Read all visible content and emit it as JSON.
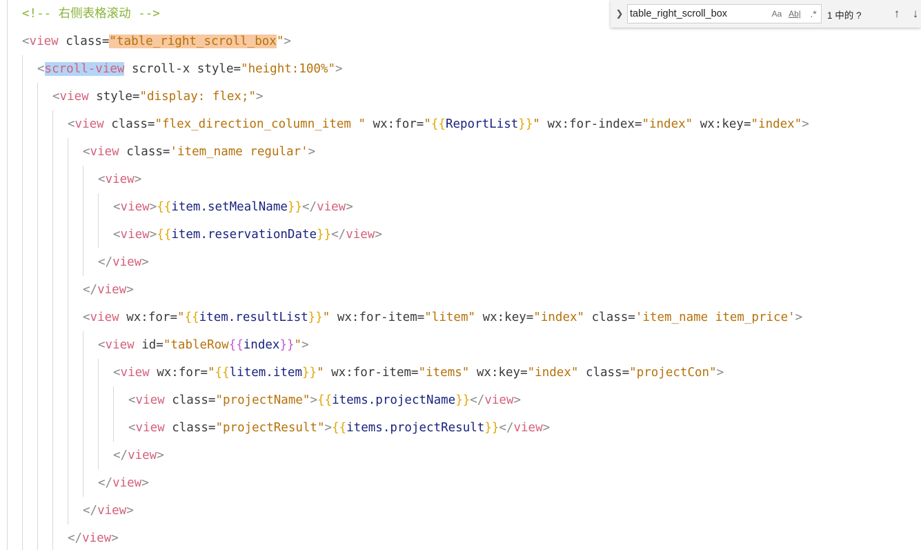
{
  "find_widget": {
    "toggle_icon": "chevron-right-icon",
    "query": "table_right_scroll_box",
    "match_case_label": "Aa",
    "whole_word_label": "Ab|",
    "regex_label": ".*",
    "match_count": "1 中的 ?",
    "prev_icon": "arrow-up-icon",
    "next_icon": "arrow-down-icon"
  },
  "editor": {
    "lines": [
      {
        "indent": 1,
        "tokens": [
          {
            "t": "<!-- 右侧表格滚动 -->",
            "c": "comment"
          }
        ]
      },
      {
        "indent": 1,
        "tokens": [
          {
            "t": "<",
            "c": "punct"
          },
          {
            "t": "view",
            "c": "tag"
          },
          {
            "t": " class=",
            "c": "attr"
          },
          {
            "t": "\"",
            "c": "str",
            "h": "find"
          },
          {
            "t": "table_right_scroll_box",
            "c": "str",
            "h": "find"
          },
          {
            "t": "\"",
            "c": "str"
          },
          {
            "t": ">",
            "c": "punct"
          }
        ]
      },
      {
        "indent": 2,
        "tokens": [
          {
            "t": "<",
            "c": "punct"
          },
          {
            "t": "scroll-view",
            "c": "tag",
            "h": "word"
          },
          {
            "t": " scroll-x style=",
            "c": "attr"
          },
          {
            "t": "\"height:100%\"",
            "c": "str"
          },
          {
            "t": ">",
            "c": "punct"
          }
        ]
      },
      {
        "indent": 3,
        "tokens": [
          {
            "t": "<",
            "c": "punct"
          },
          {
            "t": "view",
            "c": "tag"
          },
          {
            "t": " style=",
            "c": "attr"
          },
          {
            "t": "\"display: flex;\"",
            "c": "str"
          },
          {
            "t": ">",
            "c": "punct"
          }
        ]
      },
      {
        "indent": 4,
        "tokens": [
          {
            "t": "<",
            "c": "punct"
          },
          {
            "t": "view",
            "c": "tag"
          },
          {
            "t": " class=",
            "c": "attr"
          },
          {
            "t": "\"flex_direction_column_item \"",
            "c": "str"
          },
          {
            "t": " wx:for=",
            "c": "attr"
          },
          {
            "t": "\"",
            "c": "str"
          },
          {
            "t": "{{",
            "c": "brace"
          },
          {
            "t": "ReportList",
            "c": "var"
          },
          {
            "t": "}}",
            "c": "brace"
          },
          {
            "t": "\"",
            "c": "str"
          },
          {
            "t": " wx:for-index=",
            "c": "attr"
          },
          {
            "t": "\"index\"",
            "c": "str"
          },
          {
            "t": " wx:key=",
            "c": "attr"
          },
          {
            "t": "\"index\"",
            "c": "str"
          },
          {
            "t": ">",
            "c": "punct"
          }
        ]
      },
      {
        "indent": 5,
        "tokens": [
          {
            "t": "<",
            "c": "punct"
          },
          {
            "t": "view",
            "c": "tag"
          },
          {
            "t": " class=",
            "c": "attr"
          },
          {
            "t": "'item_name regular'",
            "c": "str"
          },
          {
            "t": ">",
            "c": "punct"
          }
        ]
      },
      {
        "indent": 6,
        "tokens": [
          {
            "t": "<",
            "c": "punct"
          },
          {
            "t": "view",
            "c": "tag"
          },
          {
            "t": ">",
            "c": "punct"
          }
        ]
      },
      {
        "indent": 7,
        "tokens": [
          {
            "t": "<",
            "c": "punct"
          },
          {
            "t": "view",
            "c": "tag"
          },
          {
            "t": ">",
            "c": "punct"
          },
          {
            "t": "{{",
            "c": "brace"
          },
          {
            "t": "item.setMealName",
            "c": "var"
          },
          {
            "t": "}}",
            "c": "brace"
          },
          {
            "t": "</",
            "c": "punct"
          },
          {
            "t": "view",
            "c": "tag"
          },
          {
            "t": ">",
            "c": "punct"
          }
        ]
      },
      {
        "indent": 7,
        "tokens": [
          {
            "t": "<",
            "c": "punct"
          },
          {
            "t": "view",
            "c": "tag"
          },
          {
            "t": ">",
            "c": "punct"
          },
          {
            "t": "{{",
            "c": "brace"
          },
          {
            "t": "item.reservationDate",
            "c": "var"
          },
          {
            "t": "}}",
            "c": "brace"
          },
          {
            "t": "</",
            "c": "punct"
          },
          {
            "t": "view",
            "c": "tag"
          },
          {
            "t": ">",
            "c": "punct"
          }
        ]
      },
      {
        "indent": 6,
        "tokens": [
          {
            "t": "</",
            "c": "punct"
          },
          {
            "t": "view",
            "c": "tag"
          },
          {
            "t": ">",
            "c": "punct"
          }
        ]
      },
      {
        "indent": 5,
        "tokens": [
          {
            "t": "</",
            "c": "punct"
          },
          {
            "t": "view",
            "c": "tag"
          },
          {
            "t": ">",
            "c": "punct"
          }
        ]
      },
      {
        "indent": 5,
        "tokens": [
          {
            "t": "<",
            "c": "punct"
          },
          {
            "t": "view",
            "c": "tag"
          },
          {
            "t": " wx:for=",
            "c": "attr"
          },
          {
            "t": "\"",
            "c": "str"
          },
          {
            "t": "{{",
            "c": "brace"
          },
          {
            "t": "item.resultList",
            "c": "var"
          },
          {
            "t": "}}",
            "c": "brace"
          },
          {
            "t": "\"",
            "c": "str"
          },
          {
            "t": " wx:for-item=",
            "c": "attr"
          },
          {
            "t": "\"litem\"",
            "c": "str"
          },
          {
            "t": " wx:key=",
            "c": "attr"
          },
          {
            "t": "\"index\"",
            "c": "str"
          },
          {
            "t": " class=",
            "c": "attr"
          },
          {
            "t": "'item_name item_price'",
            "c": "str"
          },
          {
            "t": ">",
            "c": "punct"
          }
        ]
      },
      {
        "indent": 6,
        "tokens": [
          {
            "t": "<",
            "c": "punct"
          },
          {
            "t": "view",
            "c": "tag"
          },
          {
            "t": " id=",
            "c": "attr"
          },
          {
            "t": "\"tableRow",
            "c": "str"
          },
          {
            "t": "{{",
            "c": "brace2"
          },
          {
            "t": "index",
            "c": "var"
          },
          {
            "t": "}}",
            "c": "brace2"
          },
          {
            "t": "\"",
            "c": "str"
          },
          {
            "t": ">",
            "c": "punct"
          }
        ]
      },
      {
        "indent": 7,
        "tokens": [
          {
            "t": "<",
            "c": "punct"
          },
          {
            "t": "view",
            "c": "tag"
          },
          {
            "t": " wx:for=",
            "c": "attr"
          },
          {
            "t": "\"",
            "c": "str"
          },
          {
            "t": "{{",
            "c": "brace"
          },
          {
            "t": "litem.item",
            "c": "var"
          },
          {
            "t": "}}",
            "c": "brace"
          },
          {
            "t": "\"",
            "c": "str"
          },
          {
            "t": " wx:for-item=",
            "c": "attr"
          },
          {
            "t": "\"items\"",
            "c": "str"
          },
          {
            "t": " wx:key=",
            "c": "attr"
          },
          {
            "t": "\"index\"",
            "c": "str"
          },
          {
            "t": " class=",
            "c": "attr"
          },
          {
            "t": "\"projectCon\"",
            "c": "str"
          },
          {
            "t": ">",
            "c": "punct"
          }
        ]
      },
      {
        "indent": 8,
        "tokens": [
          {
            "t": "<",
            "c": "punct"
          },
          {
            "t": "view",
            "c": "tag"
          },
          {
            "t": " class=",
            "c": "attr"
          },
          {
            "t": "\"projectName\"",
            "c": "str"
          },
          {
            "t": ">",
            "c": "punct"
          },
          {
            "t": "{{",
            "c": "brace"
          },
          {
            "t": "items.projectName",
            "c": "var"
          },
          {
            "t": "}}",
            "c": "brace"
          },
          {
            "t": "</",
            "c": "punct"
          },
          {
            "t": "view",
            "c": "tag"
          },
          {
            "t": ">",
            "c": "punct"
          }
        ]
      },
      {
        "indent": 8,
        "tokens": [
          {
            "t": "<",
            "c": "punct"
          },
          {
            "t": "view",
            "c": "tag"
          },
          {
            "t": " class=",
            "c": "attr"
          },
          {
            "t": "\"projectResult\"",
            "c": "str"
          },
          {
            "t": ">",
            "c": "punct"
          },
          {
            "t": "{{",
            "c": "brace"
          },
          {
            "t": "items.projectResult",
            "c": "var"
          },
          {
            "t": "}}",
            "c": "brace"
          },
          {
            "t": "</",
            "c": "punct"
          },
          {
            "t": "view",
            "c": "tag"
          },
          {
            "t": ">",
            "c": "punct"
          }
        ]
      },
      {
        "indent": 7,
        "tokens": [
          {
            "t": "</",
            "c": "punct"
          },
          {
            "t": "view",
            "c": "tag"
          },
          {
            "t": ">",
            "c": "punct"
          }
        ]
      },
      {
        "indent": 6,
        "tokens": [
          {
            "t": "</",
            "c": "punct"
          },
          {
            "t": "view",
            "c": "tag"
          },
          {
            "t": ">",
            "c": "punct"
          }
        ]
      },
      {
        "indent": 5,
        "tokens": [
          {
            "t": "</",
            "c": "punct"
          },
          {
            "t": "view",
            "c": "tag"
          },
          {
            "t": ">",
            "c": "punct"
          }
        ]
      },
      {
        "indent": 4,
        "tokens": [
          {
            "t": "</",
            "c": "punct"
          },
          {
            "t": "view",
            "c": "tag"
          },
          {
            "t": ">",
            "c": "punct"
          }
        ]
      }
    ]
  }
}
